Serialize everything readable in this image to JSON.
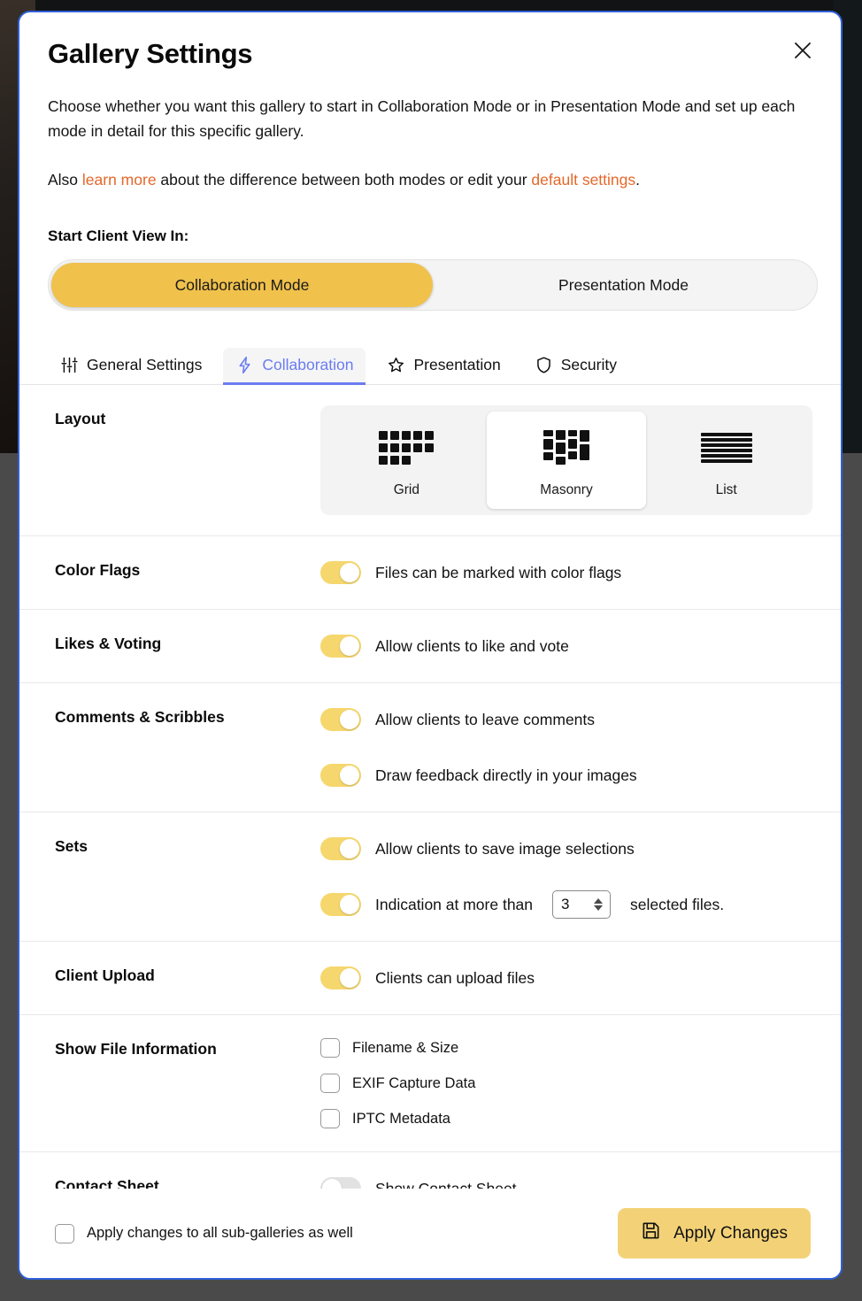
{
  "dialog": {
    "title": "Gallery Settings",
    "close_label": "close-icon",
    "intro_1": "Choose whether you want this gallery to start in Collaboration Mode or in Presentation Mode and set up each mode in detail for this specific gallery.",
    "intro_2_pre": "Also ",
    "intro_2_link1": "learn more",
    "intro_2_mid": " about the difference between both modes or edit your ",
    "intro_2_link2": "default settings",
    "intro_2_post": ".",
    "border_color": "#2f5fd6",
    "link_color": "#e4682a"
  },
  "start_client_view": {
    "label": "Start Client View In:",
    "options": [
      {
        "label": "Collaboration Mode",
        "active": true
      },
      {
        "label": "Presentation Mode",
        "active": false
      }
    ],
    "active_color": "#f0c14b"
  },
  "tabs": {
    "active_color": "#6b7cf0",
    "items": [
      {
        "label": "General Settings",
        "icon": "sliders-icon",
        "active": false
      },
      {
        "label": "Collaboration",
        "icon": "lightning-bolt-icon",
        "active": true
      },
      {
        "label": "Presentation",
        "icon": "star-icon",
        "active": false
      },
      {
        "label": "Security",
        "icon": "shield-icon",
        "active": false
      }
    ]
  },
  "sections": {
    "layout": {
      "label": "Layout",
      "options": [
        {
          "label": "Grid",
          "icon": "grid-layout-icon",
          "selected": false
        },
        {
          "label": "Masonry",
          "icon": "masonry-layout-icon",
          "selected": true
        },
        {
          "label": "List",
          "icon": "list-layout-icon",
          "selected": false
        }
      ]
    },
    "color_flags": {
      "label": "Color Flags",
      "toggle_text": "Files can be marked with color flags",
      "toggle_on": true
    },
    "likes_voting": {
      "label": "Likes & Voting",
      "toggle_text": "Allow clients to like and vote",
      "toggle_on": true
    },
    "comments_scribbles": {
      "label": "Comments & Scribbles",
      "toggle_1_text": "Allow clients to leave comments",
      "toggle_1_on": true,
      "toggle_2_text": "Draw feedback directly in your images",
      "toggle_2_on": true
    },
    "sets": {
      "label": "Sets",
      "toggle_1_text": "Allow clients to save image selections",
      "toggle_1_on": true,
      "toggle_2_on": true,
      "indication_pre": "Indication at more than",
      "indication_value": "3",
      "indication_post": "selected files."
    },
    "client_upload": {
      "label": "Client Upload",
      "toggle_text": "Clients can upload files",
      "toggle_on": true
    },
    "show_file_information": {
      "label": "Show File Information",
      "checkboxes": [
        {
          "label": "Filename & Size",
          "checked": false
        },
        {
          "label": "EXIF Capture Data",
          "checked": false
        },
        {
          "label": "IPTC Metadata",
          "checked": false
        }
      ]
    },
    "contact_sheet": {
      "label": "Contact Sheet",
      "toggle_text": "Show Contact Sheet",
      "toggle_on": false
    }
  },
  "footer": {
    "apply_all_label": "Apply changes to all sub-galleries as well",
    "apply_all_checked": false,
    "apply_button_label": "Apply Changes",
    "apply_button_icon": "save-floppy-icon",
    "apply_button_color": "#f3d277"
  }
}
